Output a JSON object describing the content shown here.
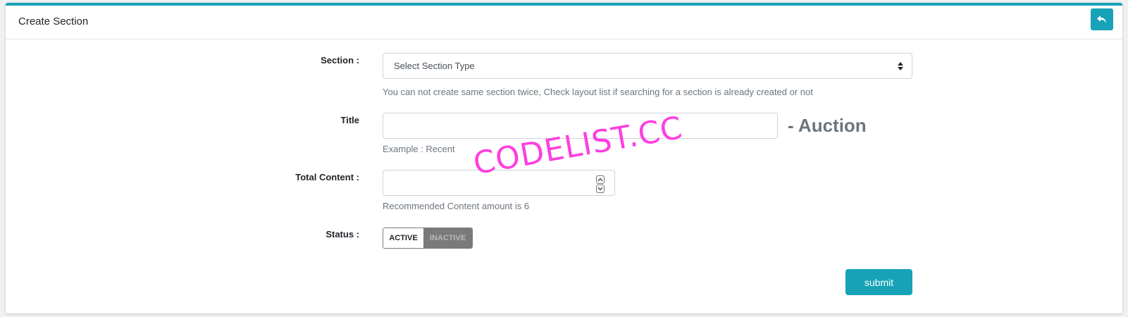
{
  "header": {
    "title": "Create Section",
    "back_icon": "reply-icon",
    "accent_color": "#17a2b8"
  },
  "form": {
    "section": {
      "label": "Section :",
      "selected": "Select Section Type",
      "help": "You can not create same section twice, Check layout list if searching for a section is already created or not"
    },
    "title": {
      "label": "Title",
      "value": "",
      "suffix": "- Auction",
      "help": "Example : Recent"
    },
    "total_content": {
      "label": "Total Content :",
      "value": "",
      "help": "Recommended Content amount is 6"
    },
    "status": {
      "label": "Status :",
      "active_label": "ACTIVE",
      "inactive_label": "INACTIVE"
    },
    "submit_label": "submit"
  },
  "watermark": "CODELIST.CC"
}
